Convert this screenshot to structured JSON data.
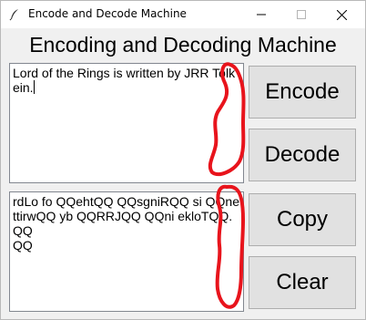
{
  "window": {
    "title": "Encode and Decode Machine",
    "controls": {
      "minimize": "minimize-icon",
      "maximize": "maximize-icon",
      "close": "close-icon"
    }
  },
  "heading": "Encoding and Decoding Machine",
  "input_text": "Lord of the Rings is written by JRR Tolkein.",
  "output_text": "rdLo fo QQehtQQ QQsgniRQQ si QQnettirwQQ yb QQRRJQQ QQni ekloTQQ.QQ\nQQ",
  "buttons": {
    "encode": "Encode",
    "decode": "Decode",
    "copy": "Copy",
    "clear": "Clear"
  },
  "colors": {
    "window_bg": "#f0f0f0",
    "button_bg": "#e1e1e1",
    "annotation_red": "#e8141c"
  }
}
